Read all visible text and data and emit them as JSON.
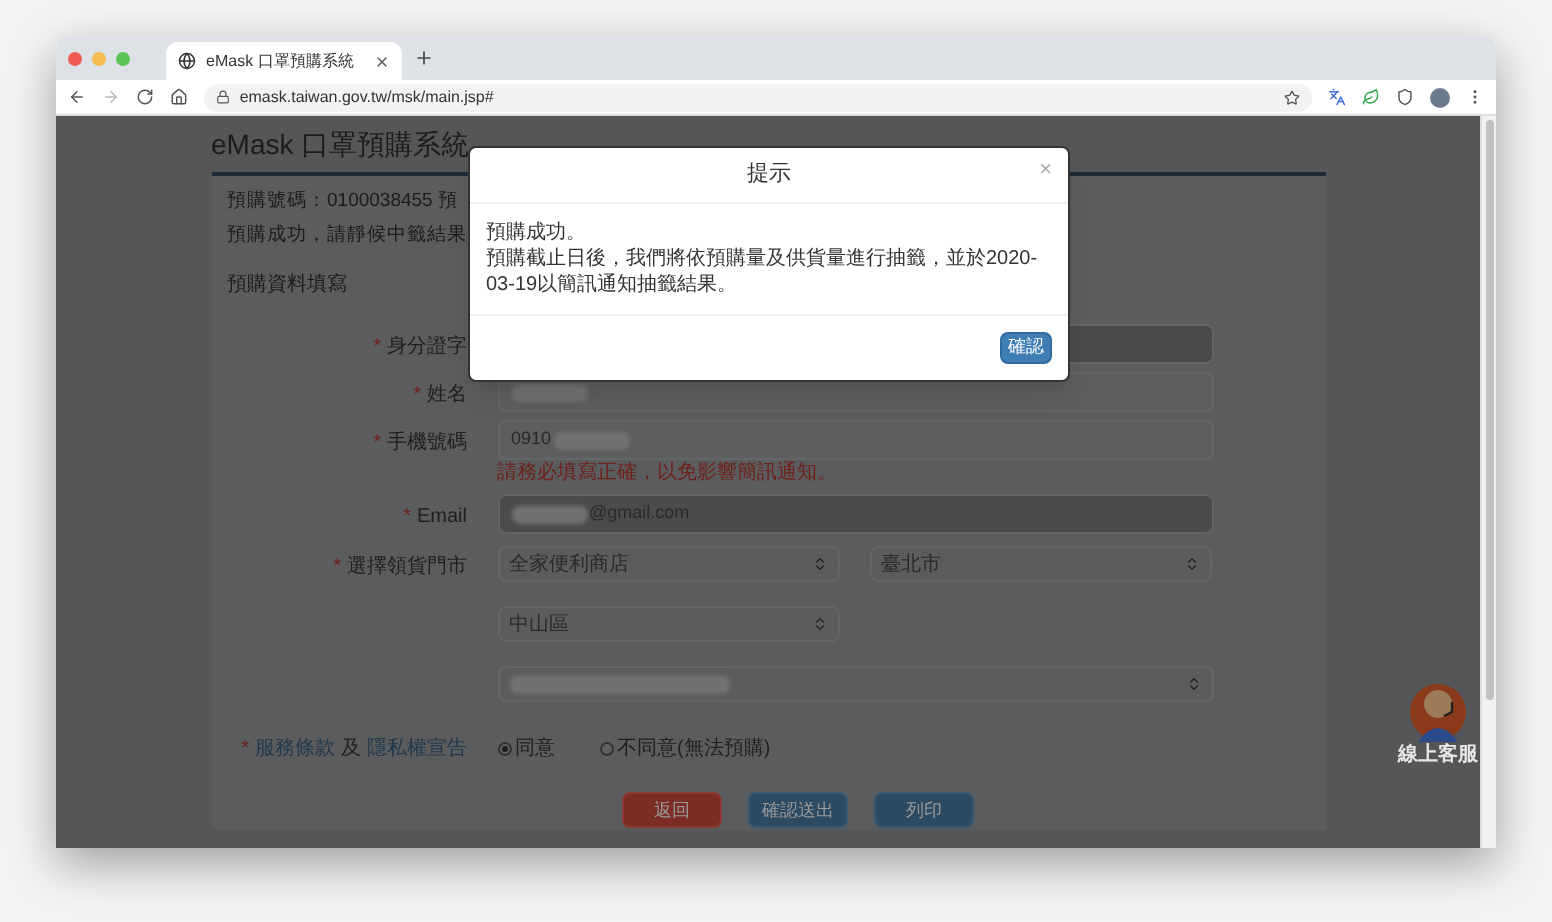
{
  "browser": {
    "tab_title": "eMask 口罩預購系統",
    "url": "emask.taiwan.gov.tw/msk/main.jsp#"
  },
  "page": {
    "title": "eMask 口罩預購系統",
    "order_line": "預購號碼：0100038455 預",
    "status_line": "預購成功，請靜候中籤結果",
    "section": "預購資料填寫",
    "required_mark": "*",
    "fields": [
      {
        "kind": "text",
        "label": "身分證字",
        "required": true,
        "disabled": true
      },
      {
        "kind": "text",
        "label": "姓名",
        "required": true,
        "disabled": false,
        "parts": [
          {
            "kind": "blur"
          }
        ]
      },
      {
        "kind": "text",
        "label": "手機號碼",
        "required": true,
        "disabled": false,
        "parts": [
          {
            "kind": "text",
            "text": "0910"
          },
          {
            "kind": "blur"
          }
        ],
        "hint": "請務必填寫正確，以免影響簡訊通知。"
      },
      {
        "kind": "text",
        "label": "Email",
        "required": true,
        "disabled": true,
        "parts": [
          {
            "kind": "blur"
          },
          {
            "kind": "text",
            "text": "@gmail.com"
          }
        ]
      },
      {
        "kind": "select",
        "label": "選擇領貨門市",
        "required": true,
        "rows": [
          [
            {
              "kind": "text",
              "text": "全家便利商店"
            },
            {
              "kind": "text",
              "text": "臺北市"
            }
          ],
          [
            {
              "kind": "text",
              "text": "中山區"
            }
          ],
          [
            {
              "kind": "blur"
            }
          ]
        ]
      },
      {
        "kind": "terms",
        "required": true,
        "label_parts": [
          {
            "kind": "link",
            "text": "服務條款"
          },
          {
            "kind": "text",
            "text": "及"
          },
          {
            "kind": "link",
            "text": "隱私權宣告"
          }
        ],
        "options": [
          {
            "label": "同意",
            "selected": true
          },
          {
            "label": "不同意(無法預購)",
            "selected": false
          }
        ]
      }
    ],
    "buttons": [
      {
        "label": "返回",
        "kind": "danger"
      },
      {
        "label": "確認送出",
        "kind": "primary"
      },
      {
        "label": "列印",
        "kind": "primary"
      }
    ],
    "support_label": "線上客服"
  },
  "dialog": {
    "title": "提示",
    "close": "×",
    "lines": [
      "預購成功。",
      "預購截止日後，我們將依預購量及供貨量進行抽籤，並於2020-03-19以簡訊通知抽籤結果。"
    ],
    "button": "確認"
  }
}
